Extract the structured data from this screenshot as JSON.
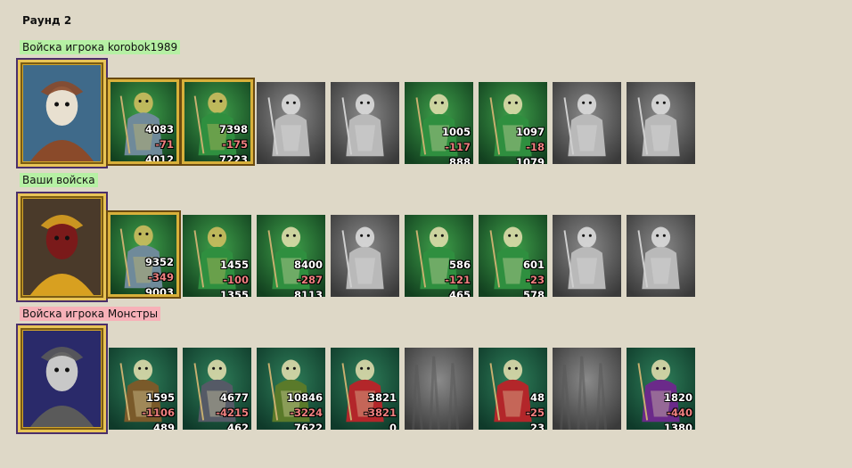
{
  "round_title": "Раунд 2",
  "colors": {
    "background": "#ded8c7",
    "ally_label": "#b6f0a4",
    "enemy_label": "#f7b1b8",
    "loss": "#f08080"
  },
  "armies": [
    {
      "label": "Войска игрока korobok1989",
      "hero_icon": "bull-skull-hero-portrait",
      "units": [
        {
          "icon": "dwarf-axeman-icon",
          "start": "4083",
          "loss": "-71",
          "end": "4012",
          "gold": true,
          "grey": false
        },
        {
          "icon": "elf-spearman-icon",
          "start": "7398",
          "loss": "-175",
          "end": "7223",
          "gold": true,
          "grey": false
        },
        {
          "icon": "knight-icon",
          "start": "",
          "loss": "",
          "end": "",
          "gold": false,
          "grey": true
        },
        {
          "icon": "griffin-icon",
          "start": "",
          "loss": "",
          "end": "",
          "gold": false,
          "grey": true
        },
        {
          "icon": "elf-archer-icon",
          "start": "1005",
          "loss": "-117",
          "end": "888",
          "gold": false,
          "grey": false
        },
        {
          "icon": "dryad-icon",
          "start": "1097",
          "loss": "-18",
          "end": "1079",
          "gold": false,
          "grey": false
        },
        {
          "icon": "hooded-monk-icon",
          "start": "",
          "loss": "",
          "end": "",
          "gold": false,
          "grey": true
        },
        {
          "icon": "stone-golem-icon",
          "start": "",
          "loss": "",
          "end": "",
          "gold": false,
          "grey": true
        }
      ]
    },
    {
      "label": "Ваши войска",
      "hero_icon": "cavalier-hero-portrait",
      "units": [
        {
          "icon": "dwarf-axeman-icon",
          "start": "9352",
          "loss": "-349",
          "end": "9003",
          "gold": true,
          "grey": false
        },
        {
          "icon": "elf-spearman-icon",
          "start": "1455",
          "loss": "-100",
          "end": "1355",
          "gold": false,
          "grey": false
        },
        {
          "icon": "knight-icon",
          "start": "8400",
          "loss": "-287",
          "end": "8113",
          "gold": false,
          "grey": false
        },
        {
          "icon": "griffin-icon",
          "start": "",
          "loss": "",
          "end": "",
          "gold": false,
          "grey": true
        },
        {
          "icon": "elf-archer-icon",
          "start": "586",
          "loss": "-121",
          "end": "465",
          "gold": false,
          "grey": false
        },
        {
          "icon": "dryad-icon",
          "start": "601",
          "loss": "-23",
          "end": "578",
          "gold": false,
          "grey": false
        },
        {
          "icon": "hooded-monk-icon",
          "start": "",
          "loss": "",
          "end": "",
          "gold": false,
          "grey": true
        },
        {
          "icon": "stone-golem-icon",
          "start": "",
          "loss": "",
          "end": "",
          "gold": false,
          "grey": true
        }
      ]
    },
    {
      "label": "Войска игрока Монстры",
      "hero_icon": "monster-lord-portrait",
      "units": [
        {
          "icon": "lizard-beast-icon",
          "start": "1595",
          "loss": "-1106",
          "end": "489",
          "gold": false,
          "grey": false
        },
        {
          "icon": "stone-gargoyle-icon",
          "start": "4677",
          "loss": "-4215",
          "end": "462",
          "gold": false,
          "grey": false
        },
        {
          "icon": "orc-warrior-icon",
          "start": "10846",
          "loss": "-3224",
          "end": "7622",
          "gold": false,
          "grey": false
        },
        {
          "icon": "red-demon-icon",
          "start": "3821",
          "loss": "-3821",
          "end": "0",
          "gold": false,
          "grey": false
        },
        {
          "icon": "empty-slot-icon",
          "start": "",
          "loss": "",
          "end": "",
          "gold": false,
          "grey": true
        },
        {
          "icon": "fire-imp-icon",
          "start": "48",
          "loss": "-25",
          "end": "23",
          "gold": false,
          "grey": false
        },
        {
          "icon": "empty-slot-icon",
          "start": "",
          "loss": "",
          "end": "",
          "gold": false,
          "grey": true
        },
        {
          "icon": "purple-dragon-icon",
          "start": "1820",
          "loss": "-440",
          "end": "1380",
          "gold": false,
          "grey": false
        }
      ]
    }
  ]
}
